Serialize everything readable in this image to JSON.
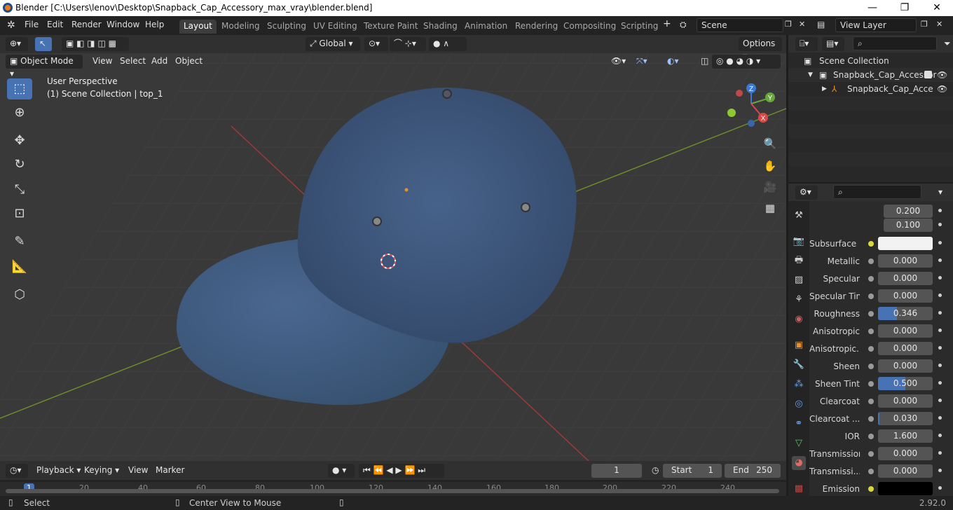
{
  "titlebar": {
    "title": "Blender [C:\\Users\\lenov\\Desktop\\Snapback_Cap_Accessory_max_vray\\blender.blend]",
    "minimize": "—",
    "maximize": "❐",
    "close": "✕"
  },
  "menu": [
    "File",
    "Edit",
    "Render",
    "Window",
    "Help"
  ],
  "workspaces": [
    "Layout",
    "Modeling",
    "Sculpting",
    "UV Editing",
    "Texture Paint",
    "Shading",
    "Animation",
    "Rendering",
    "Compositing",
    "Scripting"
  ],
  "active_workspace": "Layout",
  "scene": {
    "name": "Scene",
    "view_layer": "View Layer"
  },
  "viewport_header": {
    "orientation": "Global",
    "options": "Options",
    "mode": "Object Mode",
    "menus": [
      "View",
      "Select",
      "Add",
      "Object"
    ]
  },
  "viewport": {
    "perspective": "User Perspective",
    "collection_info": "(1) Scene Collection | top_1",
    "gizmo": {
      "z": "Z",
      "y": "Y",
      "x": "X"
    }
  },
  "tools": [
    "select-box-icon",
    "cursor-icon",
    "move-icon",
    "rotate-icon",
    "scale-icon",
    "transform-icon",
    "annotate-icon",
    "measure-icon",
    "add-cube-icon"
  ],
  "outliner": {
    "root": "Scene Collection",
    "items": [
      {
        "label": "Snapback_Cap_Accessor",
        "indent": 1
      },
      {
        "label": "Snapback_Cap_Acce",
        "indent": 2
      }
    ]
  },
  "properties": {
    "top_values": [
      "0.200",
      "0.100"
    ],
    "rows": [
      {
        "label": "Subsurface ...",
        "value": "",
        "dot": "yellow",
        "swatch": "#f2f2f2"
      },
      {
        "label": "Metallic",
        "value": "0.000",
        "fill": 0
      },
      {
        "label": "Specular",
        "value": "0.000",
        "fill": 0
      },
      {
        "label": "Specular Tin",
        "value": "0.000",
        "fill": 0
      },
      {
        "label": "Roughness",
        "value": "0.346",
        "fill": 0.346
      },
      {
        "label": "Anisotropic",
        "value": "0.000",
        "fill": 0
      },
      {
        "label": "Anisotropic...",
        "value": "0.000",
        "fill": 0
      },
      {
        "label": "Sheen",
        "value": "0.000",
        "fill": 0
      },
      {
        "label": "Sheen Tint",
        "value": "0.500",
        "fill": 0.5
      },
      {
        "label": "Clearcoat",
        "value": "0.000",
        "fill": 0
      },
      {
        "label": "Clearcoat ...",
        "value": "0.030",
        "fill": 0.03
      },
      {
        "label": "IOR",
        "value": "1.600",
        "fill": 0
      },
      {
        "label": "Transmission",
        "value": "0.000",
        "fill": 0
      },
      {
        "label": "Transmissi...",
        "value": "0.000",
        "fill": 0
      },
      {
        "label": "Emission",
        "value": "",
        "dot": "yellow",
        "swatch": "#000000"
      }
    ]
  },
  "timeline": {
    "menus": [
      "Playback",
      "Keying",
      "View",
      "Marker"
    ],
    "current_frame": "1",
    "start_label": "Start",
    "start": "1",
    "end_label": "End",
    "end": "250",
    "ruler": [
      "1",
      "20",
      "40",
      "60",
      "80",
      "100",
      "120",
      "140",
      "160",
      "180",
      "200",
      "220",
      "240"
    ]
  },
  "statusbar": {
    "left": "Select",
    "middle": "Center View to Mouse",
    "version": "2.92.0"
  },
  "colors": {
    "accent": "#4772b3",
    "viewport_bg": "#393939",
    "cap_denim": "#3e5a7e"
  }
}
